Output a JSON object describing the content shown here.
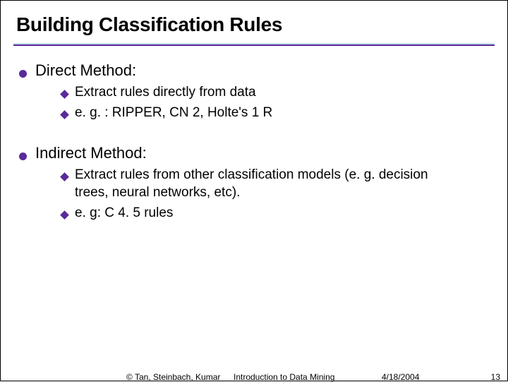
{
  "title": "Building Classification Rules",
  "sections": [
    {
      "heading": "Direct Method:",
      "items": [
        "Extract rules directly from data",
        "e. g. : RIPPER, CN 2, Holte's 1 R"
      ]
    },
    {
      "heading": "Indirect Method:",
      "items": [
        "Extract rules from other classification models (e. g. decision trees, neural networks, etc).",
        "e. g: C 4. 5 rules"
      ]
    }
  ],
  "footer": {
    "copyright": "© Tan, Steinbach, Kumar",
    "course": "Introduction to Data Mining",
    "date": "4/18/2004",
    "page": "13"
  }
}
